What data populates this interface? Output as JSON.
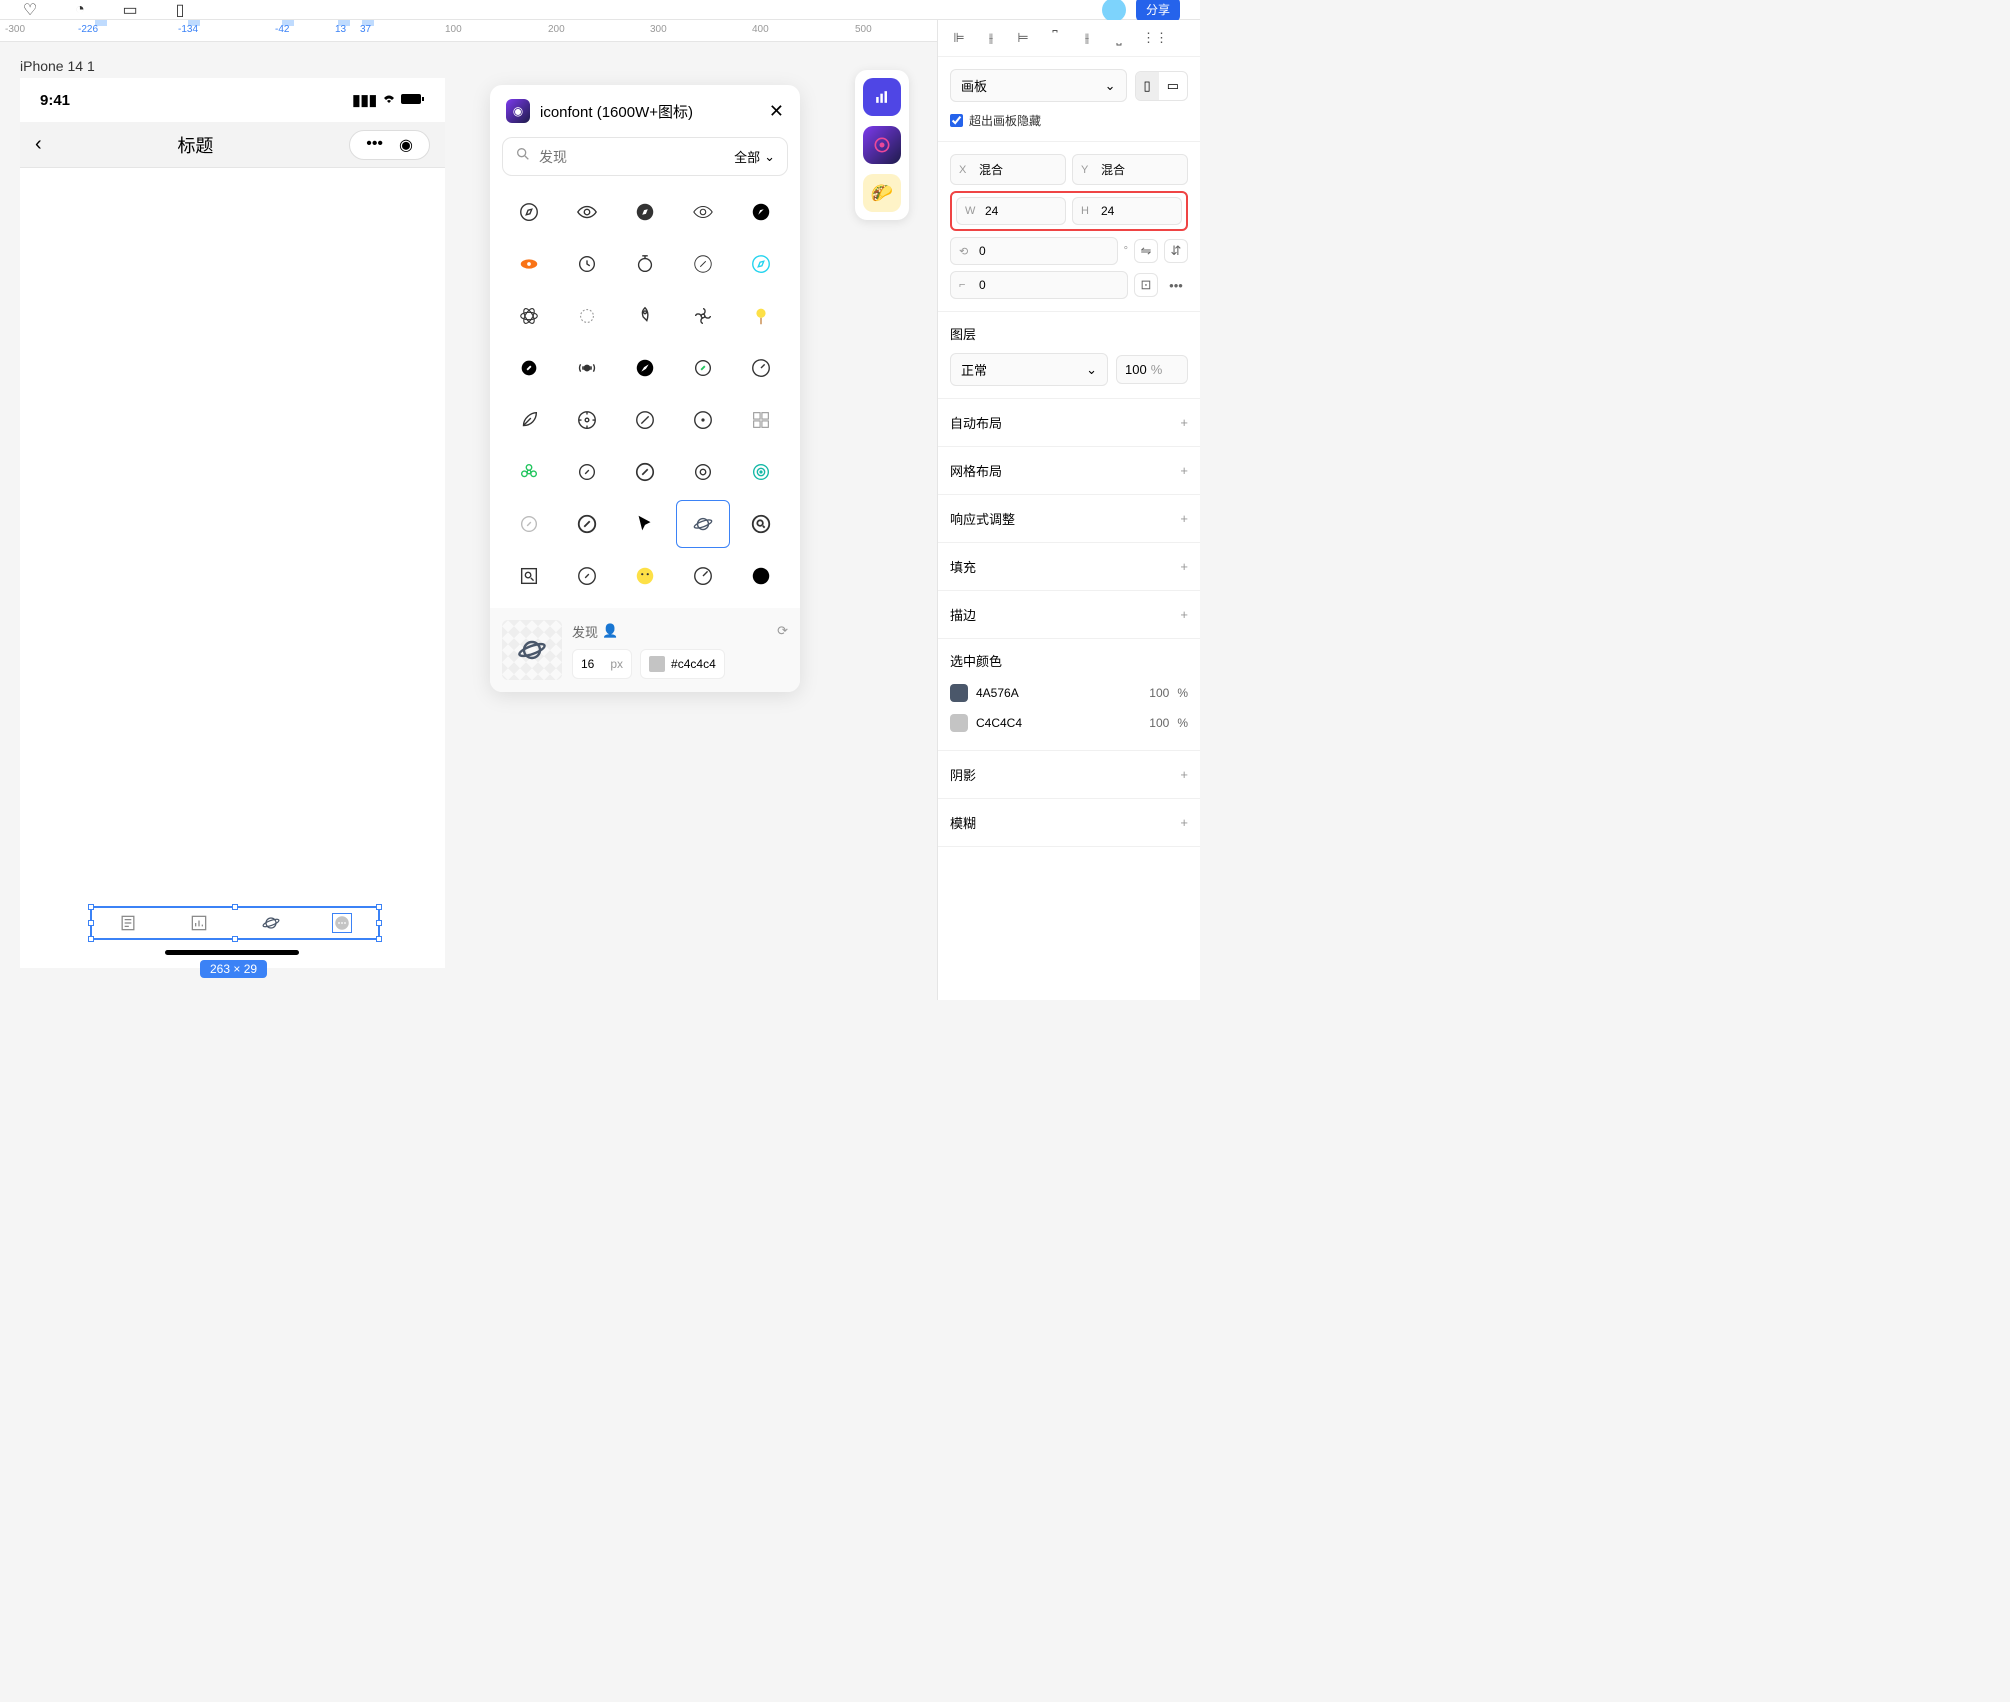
{
  "ruler": {
    "ticks": [
      "-300",
      "-226",
      "-134",
      "-42",
      "13",
      "37",
      "100",
      "200",
      "300",
      "400",
      "500"
    ]
  },
  "artboard": {
    "name": "iPhone 14 1",
    "time": "9:41",
    "title": "标题",
    "selection_size": "263 × 29"
  },
  "iconfont": {
    "title": "iconfont (1600W+图标)",
    "search_placeholder": "发现",
    "filter_label": "全部",
    "footer_name": "发现",
    "size_value": "16",
    "size_unit": "px",
    "color_value": "#c4c4c4"
  },
  "inspector": {
    "frame_select": "画板",
    "clip_label": "超出画板隐藏",
    "x_label": "X",
    "x_value": "混合",
    "y_label": "Y",
    "y_value": "混合",
    "w_label": "W",
    "w_value": "24",
    "h_label": "H",
    "h_value": "24",
    "rotate_value": "0",
    "radius_value": "0",
    "layer_title": "图层",
    "blend_mode": "正常",
    "opacity_value": "100",
    "opacity_unit": "%",
    "sections": {
      "auto_layout": "自动布局",
      "grid_layout": "网格布局",
      "responsive": "响应式调整",
      "fill": "填充",
      "stroke": "描边",
      "selected_colors": "选中颜色",
      "shadow": "阴影",
      "blur": "模糊"
    },
    "colors": [
      {
        "hex": "4A576A",
        "swatch": "#4A576A",
        "opacity": "100",
        "unit": "%"
      },
      {
        "hex": "C4C4C4",
        "swatch": "#C4C4C4",
        "opacity": "100",
        "unit": "%"
      }
    ]
  }
}
